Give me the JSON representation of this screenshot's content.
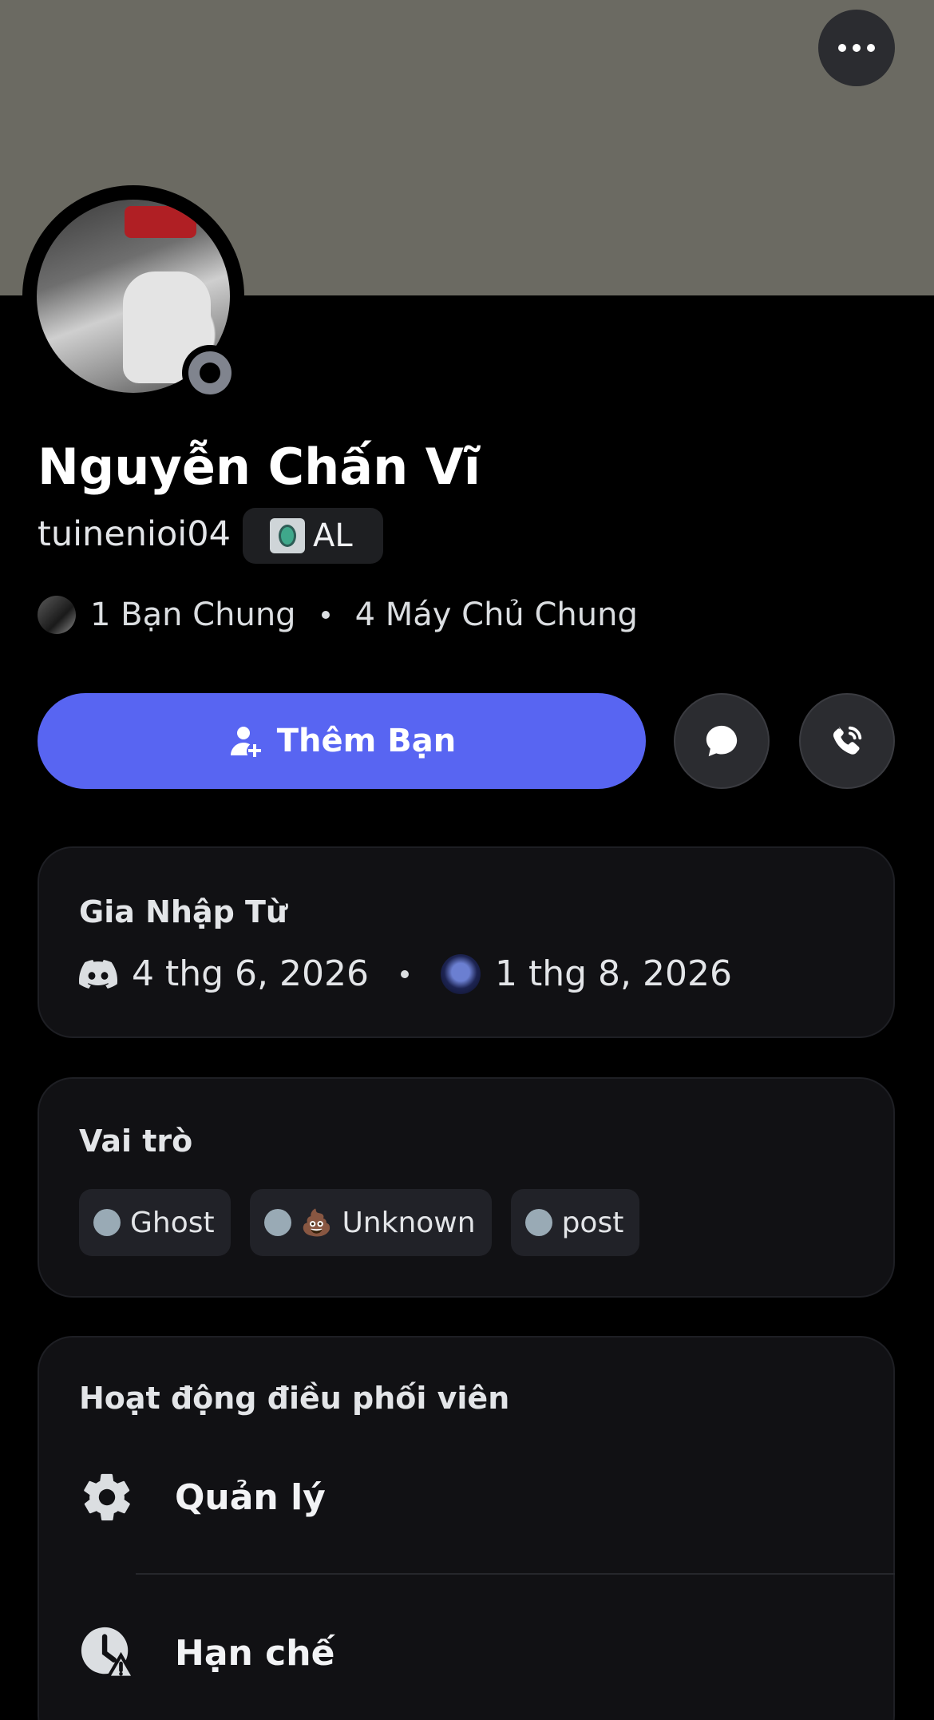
{
  "banner": {
    "color": "#6b6a62"
  },
  "header": {
    "more_icon": "more-horizontal-icon"
  },
  "profile": {
    "display_name": "Nguyễn Chấn Vĩ",
    "username": "tuinenioi04",
    "tag": "AL",
    "status": "offline",
    "mutual_friends": "1 Bạn Chung",
    "mutual_servers": "4 Máy Chủ Chung"
  },
  "actions": {
    "add_friend_label": "Thêm Bạn",
    "message_icon": "chat-bubble-icon",
    "call_icon": "phone-call-icon",
    "accent": "#5865f2"
  },
  "member_since": {
    "title": "Gia Nhập Từ",
    "discord_date": "4 thg 6, 2026",
    "server_date": "1 thg 8, 2026"
  },
  "roles": {
    "title": "Vai trò",
    "items": [
      {
        "label": "Ghost",
        "color": "#99aab5"
      },
      {
        "label": "Unknown",
        "color": "#99aab5",
        "emoji": "💩"
      },
      {
        "label": "post",
        "color": "#99aab5"
      }
    ]
  },
  "moderator": {
    "title": "Hoạt động điều phối viên",
    "items": [
      {
        "label": "Quản lý",
        "icon": "gear-icon"
      },
      {
        "label": "Hạn chế",
        "icon": "clock-warning-icon"
      }
    ]
  }
}
